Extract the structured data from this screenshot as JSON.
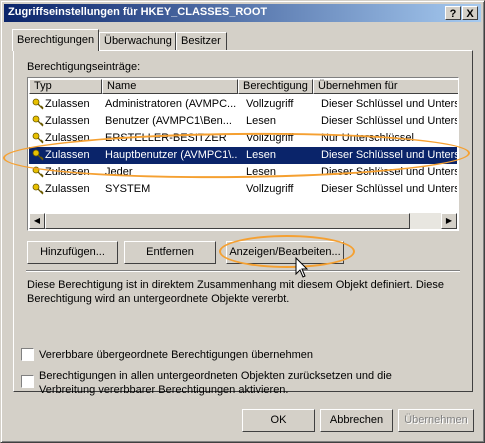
{
  "title": "Zugriffseinstellungen für HKEY_CLASSES_ROOT",
  "title_buttons": {
    "help": "?",
    "close": "X"
  },
  "tabs": [
    "Berechtigungen",
    "Überwachung",
    "Besitzer"
  ],
  "entries_label": "Berechtigungseinträge:",
  "columns": [
    "Typ",
    "Name",
    "Berechtigung",
    "Übernehmen für"
  ],
  "rows": [
    {
      "typ": "Zulassen",
      "name": "Administratoren (AVMPC...",
      "perm": "Vollzugriff",
      "applies": "Dieser Schlüssel und Unters..."
    },
    {
      "typ": "Zulassen",
      "name": "Benutzer (AVMPC1\\Ben...",
      "perm": "Lesen",
      "applies": "Dieser Schlüssel und Unters..."
    },
    {
      "typ": "Zulassen",
      "name": "ERSTELLER-BESITZER",
      "perm": "Vollzugriff",
      "applies": "Nur Unterschlüssel"
    },
    {
      "typ": "Zulassen",
      "name": "Hauptbenutzer (AVMPC1\\...",
      "perm": "Lesen",
      "applies": "Dieser Schlüssel und Unters..."
    },
    {
      "typ": "Zulassen",
      "name": "Jeder",
      "perm": "Lesen",
      "applies": "Dieser Schlüssel und Unters..."
    },
    {
      "typ": "Zulassen",
      "name": "SYSTEM",
      "perm": "Vollzugriff",
      "applies": "Dieser Schlüssel und Unters..."
    }
  ],
  "selected_row": 3,
  "buttons": {
    "add": "Hinzufügen...",
    "remove": "Entfernen",
    "view_edit": "Anzeigen/Bearbeiten..."
  },
  "description": [
    "Diese Berechtigung ist in direktem Zusammenhang mit diesem Objekt definiert. Diese",
    "Berechtigung wird an untergeordnete Objekte vererbt."
  ],
  "checkbox_inherit": "Vererbbare übergeordnete Berechtigungen übernehmen",
  "checkbox_reset": [
    "Berechtigungen in allen untergeordneten Objekten zurücksetzen und die",
    "Verbreitung vererbbarer Berechtigungen aktivieren."
  ],
  "footer": {
    "ok": "OK",
    "cancel": "Abbrechen",
    "apply": "Übernehmen"
  },
  "annotation_color": "#f5a031"
}
